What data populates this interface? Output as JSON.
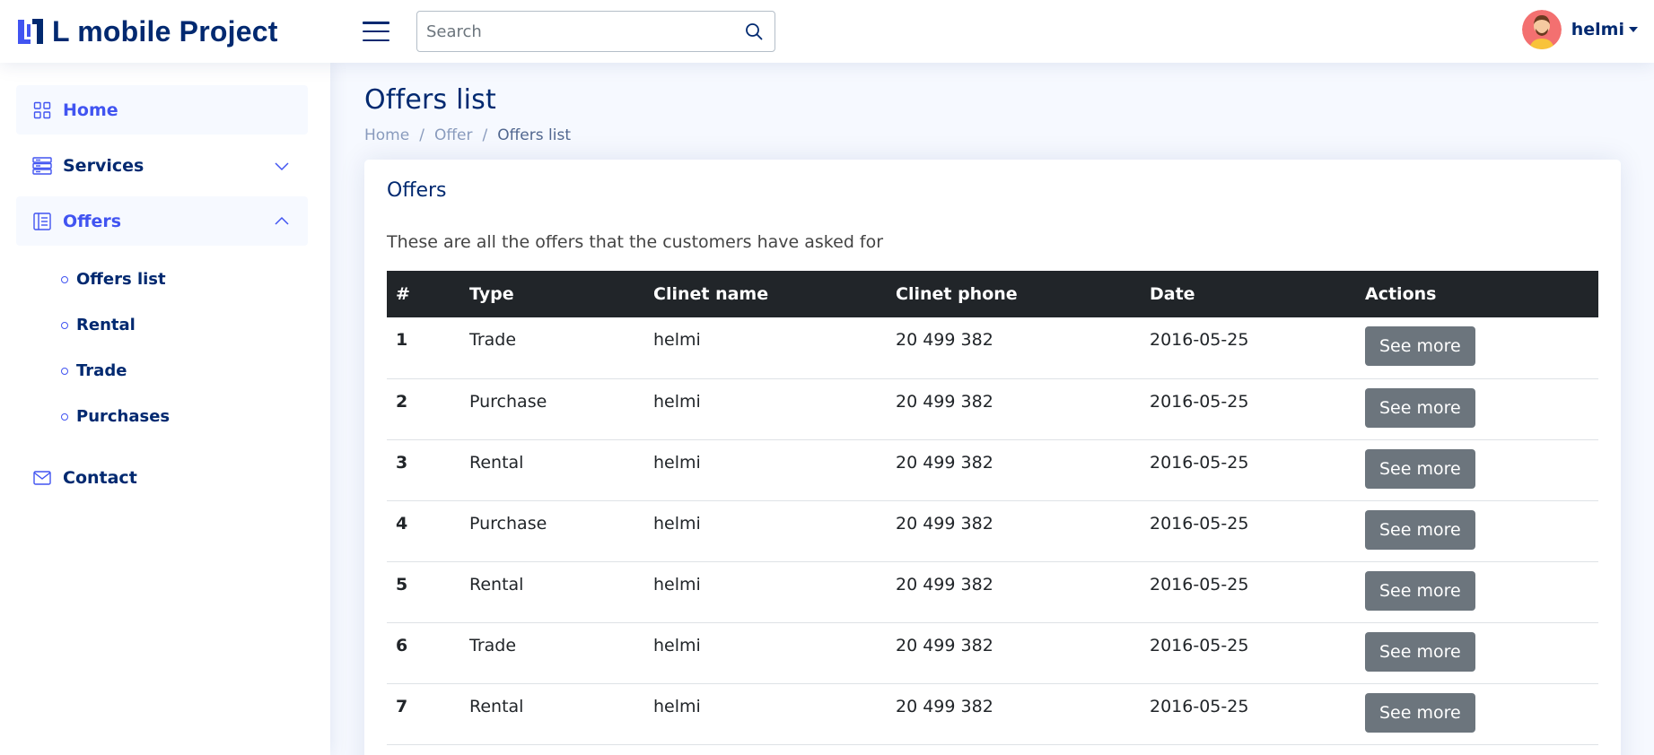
{
  "header": {
    "app_title": "L mobile Project",
    "search_placeholder": "Search",
    "user_name": "helmi"
  },
  "sidebar": {
    "items": [
      {
        "label": "Home",
        "icon": "grid-icon"
      },
      {
        "label": "Services",
        "icon": "server-icon"
      },
      {
        "label": "Offers",
        "icon": "layout-text-icon"
      },
      {
        "label": "Contact",
        "icon": "envelope-icon"
      }
    ],
    "offers_sub": [
      "Offers list",
      "Rental",
      "Trade",
      "Purchases"
    ]
  },
  "page": {
    "title": "Offers list",
    "breadcrumb": [
      "Home",
      "Offer",
      "Offers list"
    ]
  },
  "card": {
    "title": "Offers",
    "description": "These are all the offers that the customers have asked for",
    "columns": [
      "#",
      "Type",
      "Clinet name",
      "Clinet phone",
      "Date",
      "Actions"
    ],
    "rows": [
      {
        "num": "1",
        "type": "Trade",
        "name": "helmi",
        "phone": "20 499 382",
        "date": "2016-05-25",
        "action": "See more"
      },
      {
        "num": "2",
        "type": "Purchase",
        "name": "helmi",
        "phone": "20 499 382",
        "date": "2016-05-25",
        "action": "See more"
      },
      {
        "num": "3",
        "type": "Rental",
        "name": "helmi",
        "phone": "20 499 382",
        "date": "2016-05-25",
        "action": "See more"
      },
      {
        "num": "4",
        "type": "Purchase",
        "name": "helmi",
        "phone": "20 499 382",
        "date": "2016-05-25",
        "action": "See more"
      },
      {
        "num": "5",
        "type": "Rental",
        "name": "helmi",
        "phone": "20 499 382",
        "date": "2016-05-25",
        "action": "See more"
      },
      {
        "num": "6",
        "type": "Trade",
        "name": "helmi",
        "phone": "20 499 382",
        "date": "2016-05-25",
        "action": "See more"
      },
      {
        "num": "7",
        "type": "Rental",
        "name": "helmi",
        "phone": "20 499 382",
        "date": "2016-05-25",
        "action": "See more"
      }
    ]
  },
  "colors": {
    "primary": "#012970",
    "accent": "#4154f1",
    "table_header": "#212529",
    "button": "#6c757d"
  }
}
